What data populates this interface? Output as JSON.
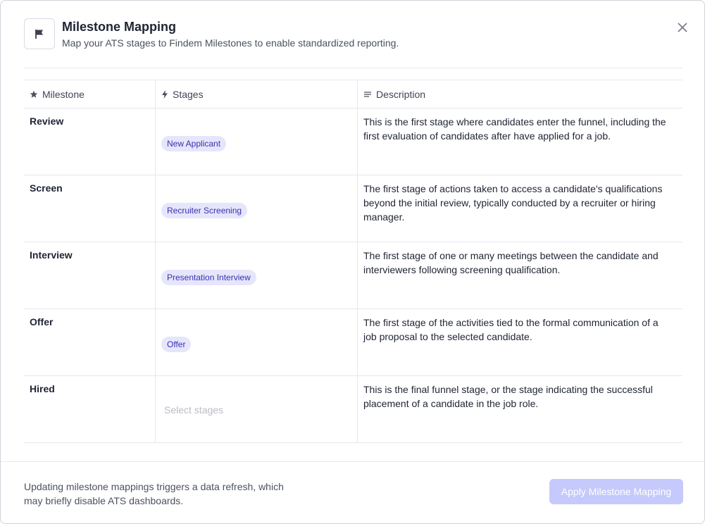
{
  "modal": {
    "title": "Milestone Mapping",
    "subtitle": "Map your ATS stages to Findem Milestones to enable standardized reporting.",
    "header_icon": "flag-icon",
    "close_icon": "close-icon"
  },
  "table": {
    "columns": [
      {
        "label": "Milestone",
        "icon": "star-icon"
      },
      {
        "label": "Stages",
        "icon": "lightning-icon"
      },
      {
        "label": "Description",
        "icon": "lines-icon"
      }
    ],
    "rows": [
      {
        "milestone": "Review",
        "stage": "New Applicant",
        "description": "This is the first stage where candidates enter the funnel, including the first evaluation of candidates after have applied for a job."
      },
      {
        "milestone": "Screen",
        "stage": "Recruiter Screening",
        "description": "The first stage of actions taken to access a candidate's qualifications beyond the initial review, typically conducted by a recruiter or hiring manager."
      },
      {
        "milestone": "Interview",
        "stage": "Presentation Interview",
        "description": "The first stage of one or many meetings between the candidate and interviewers following screening qualification."
      },
      {
        "milestone": "Offer",
        "stage": "Offer",
        "description": "The first stage of the activities tied to the formal communication of a job proposal to the selected candidate."
      },
      {
        "milestone": "Hired",
        "stage_placeholder": "Select stages",
        "description": "This is the final funnel stage, or the stage indicating the successful placement of a candidate in the job role."
      }
    ]
  },
  "footer": {
    "note": "Updating milestone mappings triggers a data refresh, which may briefly disable ATS dashboards.",
    "apply_label": "Apply Milestone Mapping"
  },
  "colors": {
    "chip_bg": "#e5e6fb",
    "chip_text": "#3b2fb0",
    "apply_disabled_bg": "#c6c9fb"
  }
}
